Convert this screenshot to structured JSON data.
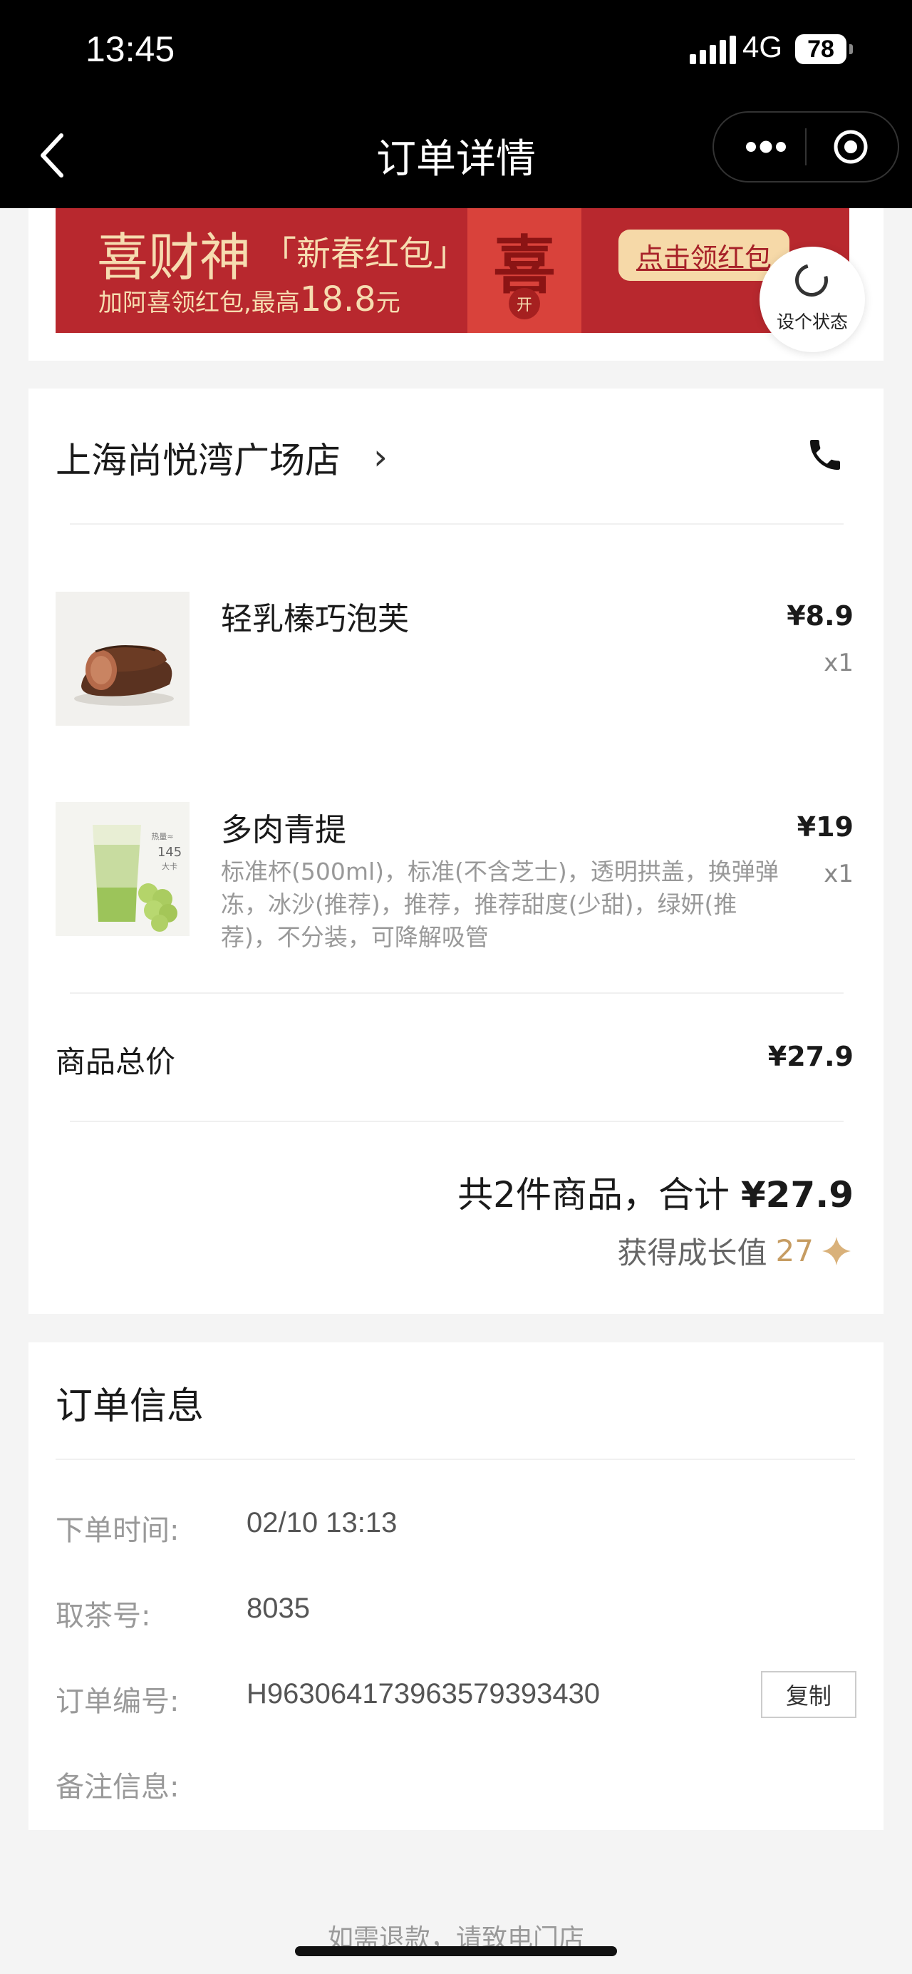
{
  "status_bar": {
    "time": "13:45",
    "network": "4G",
    "battery": "78"
  },
  "nav": {
    "title": "订单详情"
  },
  "banner": {
    "title": "喜财神",
    "subtitle": "「新春红包」",
    "line": "加阿喜领红包,最高",
    "amount": "18.8",
    "unit": "元",
    "envelope_char": "喜",
    "envelope_open": "开",
    "button": "点击领红包"
  },
  "status_fab": {
    "label": "设个状态"
  },
  "store": {
    "name": "上海尚悦湾广场店",
    "chevron": "›"
  },
  "items": [
    {
      "name": "轻乳榛巧泡芙",
      "price": "¥8.9",
      "qty": "x1",
      "spec": ""
    },
    {
      "name": "多肉青提",
      "price": "¥19",
      "qty": "x1",
      "spec": "标准杯(500ml)，标准(不含芝士)，透明拱盖，换弹弹冻，冰沙(推荐)，推荐，推荐甜度(少甜)，绿妍(推荐)，不分装，可降解吸管",
      "cup_label_top": "热量≈",
      "cup_label_num": "145",
      "cup_label_unit": "大卡"
    }
  ],
  "summary": {
    "subtotal_label": "商品总价",
    "subtotal_value": "¥27.9",
    "total_prefix": "共2件商品，合计 ",
    "total_value": "¥27.9",
    "growth_label": "获得成长值",
    "growth_value": "27"
  },
  "order_info": {
    "title": "订单信息",
    "rows": [
      {
        "label": "下单时间:",
        "value": "02/10 13:13"
      },
      {
        "label": "取茶号:",
        "value": "8035"
      },
      {
        "label": "订单编号:",
        "value": "H963064173963579393430"
      },
      {
        "label": "备注信息:",
        "value": ""
      }
    ],
    "copy_button": "复制"
  },
  "footer": {
    "note": "如需退款，请致电门店"
  },
  "colors": {
    "brand_red": "#b8282e",
    "gold": "#c69c62",
    "muted": "#999999"
  }
}
